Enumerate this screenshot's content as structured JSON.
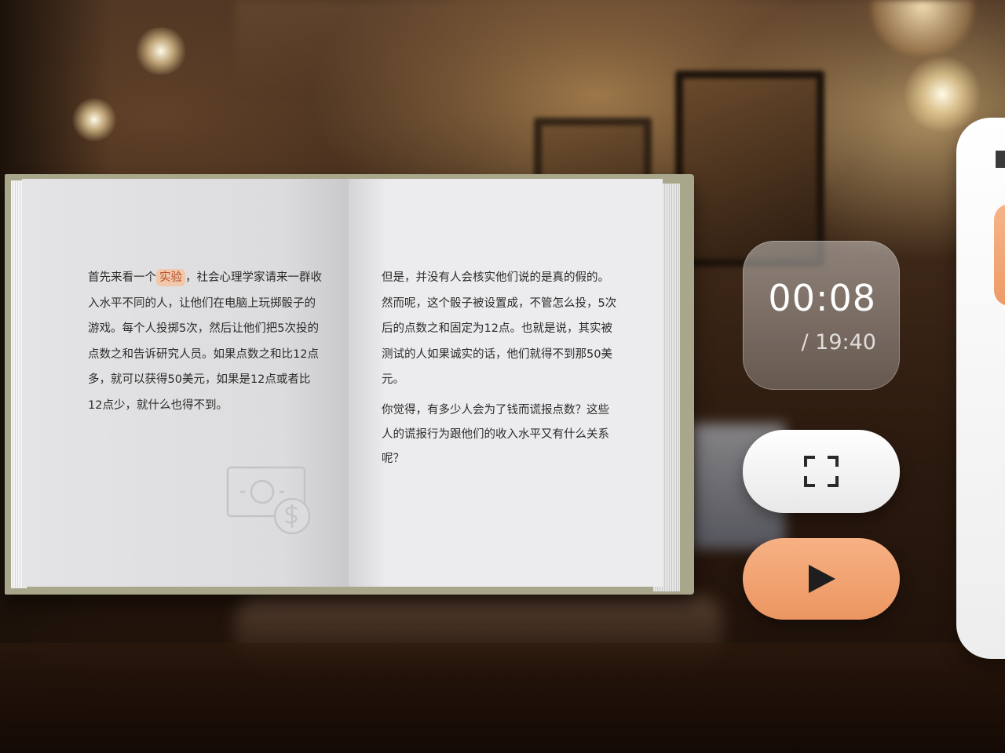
{
  "book": {
    "left_page": {
      "before_highlight": "首先来看一个",
      "highlight": "实验",
      "after_highlight": "，社会心理学家请来一群收入水平不同的人，让他们在电脑上玩掷骰子的游戏。每个人投掷5次，然后让他们把5次投的点数之和告诉研究人员。如果点数之和比12点多，就可以获得50美元，如果是12点或者比12点少，就什么也得不到。",
      "icon": "money-icon"
    },
    "right_page": {
      "paragraph_1": "但是，并没有人会核实他们说的是真的假的。然而呢，这个骰子被设置成，不管怎么投，5次后的点数之和固定为12点。也就是说，其实被测试的人如果诚实的话，他们就得不到那50美元。",
      "paragraph_2": "你觉得，有多少人会为了钱而谎报点数？这些人的谎报行为跟他们的收入水平又有什么关系呢？"
    }
  },
  "player": {
    "current_time": "00:08",
    "total_time": "/ 19:40",
    "fullscreen_icon": "fullscreen-icon",
    "play_icon": "play-icon"
  },
  "colors": {
    "accent": "#ef9c68",
    "highlight_bg": "#f2c8ac",
    "highlight_text": "#b24e2a"
  }
}
